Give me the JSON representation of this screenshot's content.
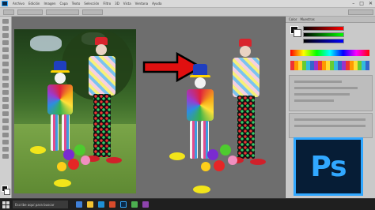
{
  "app": {
    "menu": [
      "Archivo",
      "Edición",
      "Imagen",
      "Capa",
      "Texto",
      "Selección",
      "Filtro",
      "3D",
      "Vista",
      "Ventana",
      "Ayuda"
    ],
    "window_buttons": [
      "–",
      "□",
      "✕"
    ]
  },
  "panels": {
    "tabs": [
      "Color",
      "Muestras"
    ]
  },
  "logo": {
    "text": "Ps",
    "colors": {
      "background": "#061d36",
      "accent": "#31a8ff"
    }
  },
  "arrow": {
    "color": "#e01010",
    "outline": "#000000"
  },
  "taskbar": {
    "search_placeholder": "Escribe aquí para buscar",
    "clock_time": "",
    "clock_date": ""
  },
  "icons": [
    "windows-start-icon",
    "search-icon",
    "file-explorer-icon",
    "browser-icon",
    "photoshop-taskbar-icon"
  ]
}
